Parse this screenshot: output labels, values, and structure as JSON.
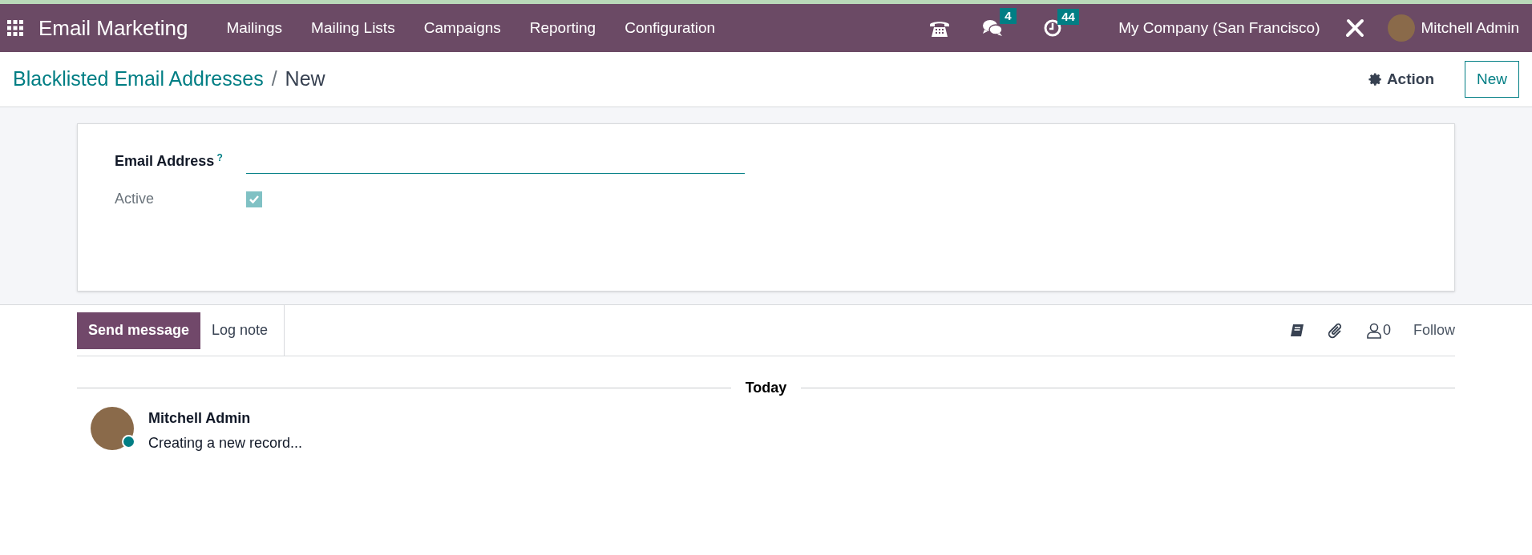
{
  "navbar": {
    "app_name": "Email Marketing",
    "menu": [
      "Mailings",
      "Mailing Lists",
      "Campaigns",
      "Reporting",
      "Configuration"
    ],
    "messages_count": "4",
    "activities_count": "44",
    "company": "My Company (San Francisco)",
    "user": "Mitchell Admin"
  },
  "breadcrumb": {
    "parent": "Blacklisted Email Addresses",
    "separator": "/",
    "current": "New"
  },
  "control_panel": {
    "action": "Action",
    "new_button": "New"
  },
  "form": {
    "fields": [
      {
        "kind": "text",
        "label": "Email Address",
        "help": "?"
      },
      {
        "kind": "checkbox",
        "label": "Active",
        "checked": true
      }
    ]
  },
  "chatter": {
    "tabs": [
      {
        "label": "Send message",
        "selected": true
      },
      {
        "label": "Log note",
        "selected": false
      }
    ],
    "followers_count": "0",
    "follow": "Follow",
    "date_separator": "Today",
    "messages": [
      {
        "author": "Mitchell Admin",
        "body": "Creating a new record...",
        "online": true
      }
    ]
  }
}
